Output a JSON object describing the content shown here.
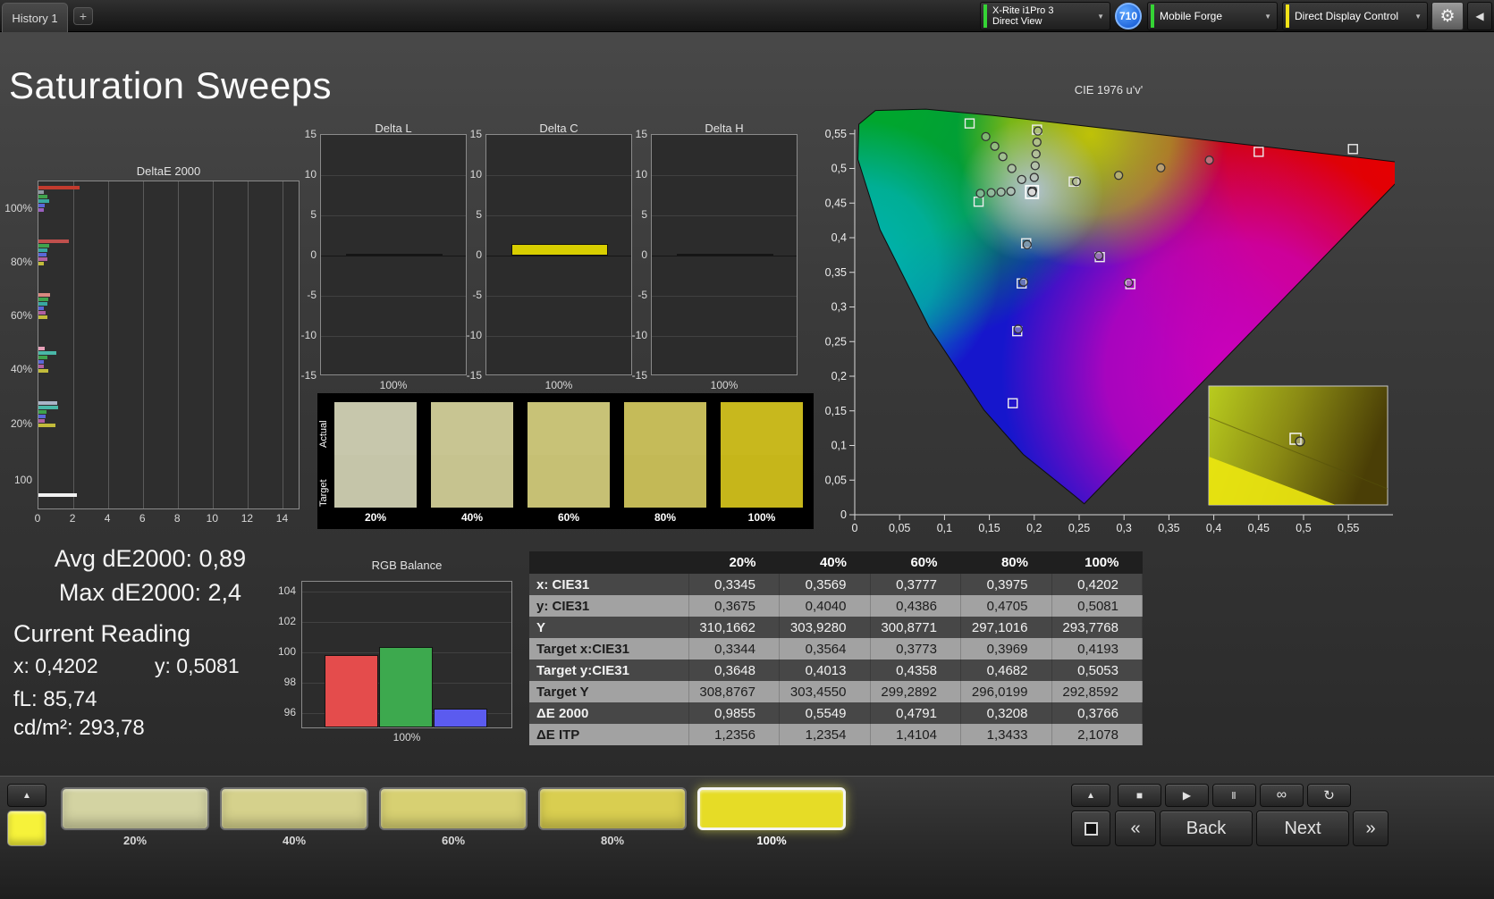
{
  "top_bar": {
    "tab_label": "History 1",
    "add_tab_label": "+",
    "meter_line1": "X-Rite i1Pro 3",
    "meter_line2": "Direct View",
    "meter_status_color": "#35d435",
    "badge_label": "710",
    "workflow_label": "Mobile Forge",
    "workflow_status_color": "#35d435",
    "display_label": "Direct Display Control",
    "display_status_color": "#f2e318",
    "dropdown_icon": "▼",
    "gear_icon": "⚙",
    "collapse_icon": "◀"
  },
  "page": {
    "title": "Saturation Sweeps"
  },
  "stats": {
    "avg_label": "Avg dE2000: 0,89",
    "max_label": "Max dE2000: 2,4",
    "current_heading": "Current Reading",
    "x_label": "x: 0,4202",
    "y_label": "y: 0,5081",
    "fl_label": "fL: 85,74",
    "cd_label": "cd/m²: 293,78"
  },
  "swatches": {
    "row_label_top": "Actual",
    "row_label_bottom": "Target",
    "items": [
      {
        "label": "20%",
        "actual": "#c7c7ac",
        "target": "#c5c5a9"
      },
      {
        "label": "40%",
        "actual": "#c8c592",
        "target": "#c6c38f"
      },
      {
        "label": "60%",
        "actual": "#c8c277",
        "target": "#c6c074"
      },
      {
        "label": "80%",
        "actual": "#c5bb59",
        "target": "#c3b956"
      },
      {
        "label": "100%",
        "actual": "#c8b81d",
        "target": "#c6b61a"
      }
    ]
  },
  "results_table": {
    "headers": [
      "",
      "20%",
      "40%",
      "60%",
      "80%",
      "100%"
    ],
    "rows": [
      {
        "label": "x: CIE31",
        "values": [
          "0,3345",
          "0,3569",
          "0,3777",
          "0,3975",
          "0,4202"
        ]
      },
      {
        "label": "y: CIE31",
        "values": [
          "0,3675",
          "0,4040",
          "0,4386",
          "0,4705",
          "0,5081"
        ]
      },
      {
        "label": "Y",
        "values": [
          "310,1662",
          "303,9280",
          "300,8771",
          "297,1016",
          "293,7768"
        ]
      },
      {
        "label": "Target x:CIE31",
        "values": [
          "0,3344",
          "0,3564",
          "0,3773",
          "0,3969",
          "0,4193"
        ]
      },
      {
        "label": "Target y:CIE31",
        "values": [
          "0,3648",
          "0,4013",
          "0,4358",
          "0,4682",
          "0,5053"
        ]
      },
      {
        "label": "Target Y",
        "values": [
          "308,8767",
          "303,4550",
          "299,2892",
          "296,0199",
          "292,8592"
        ]
      },
      {
        "label": "ΔE 2000",
        "values": [
          "0,9855",
          "0,5549",
          "0,4791",
          "0,3208",
          "0,3766"
        ]
      },
      {
        "label": "ΔE ITP",
        "values": [
          "1,2356",
          "1,2354",
          "1,4104",
          "1,3433",
          "2,1078"
        ]
      }
    ]
  },
  "chart_data": [
    {
      "id": "deltaE2000",
      "type": "bar",
      "orientation": "horizontal",
      "title": "DeltaE 2000",
      "xlim": [
        0,
        15
      ],
      "xticks": [
        0,
        2,
        4,
        6,
        8,
        10,
        12,
        14
      ],
      "ytick_labels": [
        "100%",
        "80%",
        "60%",
        "40%",
        "20%",
        "100"
      ],
      "groups": [
        {
          "label": "100%",
          "bars": [
            {
              "color": "#c23b2e",
              "value": 2.35
            },
            {
              "color": "#8f98a3",
              "value": 0.3
            },
            {
              "color": "#3fa34d",
              "value": 0.5
            },
            {
              "color": "#38a8a0",
              "value": 0.62
            },
            {
              "color": "#5a67d8",
              "value": 0.38
            },
            {
              "color": "#9a5fc0",
              "value": 0.3
            }
          ]
        },
        {
          "label": "80%",
          "bars": [
            {
              "color": "#c0504d",
              "value": 1.75
            },
            {
              "color": "#3fa34d",
              "value": 0.6
            },
            {
              "color": "#38a8a0",
              "value": 0.5
            },
            {
              "color": "#5a67d8",
              "value": 0.45
            },
            {
              "color": "#b05fa0",
              "value": 0.5
            },
            {
              "color": "#c2bb3a",
              "value": 0.3
            }
          ]
        },
        {
          "label": "60%",
          "bars": [
            {
              "color": "#d98880",
              "value": 0.68
            },
            {
              "color": "#3fa34d",
              "value": 0.55
            },
            {
              "color": "#38a8a0",
              "value": 0.5
            },
            {
              "color": "#5a67d8",
              "value": 0.3
            },
            {
              "color": "#b05fa0",
              "value": 0.42
            },
            {
              "color": "#c2bb3a",
              "value": 0.5
            }
          ]
        },
        {
          "label": "40%",
          "bars": [
            {
              "color": "#e6a0b8",
              "value": 0.38
            },
            {
              "color": "#49b8a8",
              "value": 1.0
            },
            {
              "color": "#3fa34d",
              "value": 0.5
            },
            {
              "color": "#5a67d8",
              "value": 0.33
            },
            {
              "color": "#b05fa0",
              "value": 0.3
            },
            {
              "color": "#c2bb3a",
              "value": 0.55
            }
          ]
        },
        {
          "label": "20%",
          "bars": [
            {
              "color": "#aab4c8",
              "value": 1.05
            },
            {
              "color": "#49b8a8",
              "value": 1.15
            },
            {
              "color": "#3fa34d",
              "value": 0.45
            },
            {
              "color": "#5a67d8",
              "value": 0.4
            },
            {
              "color": "#b05fa0",
              "value": 0.35
            },
            {
              "color": "#c2bb3a",
              "value": 0.98
            }
          ]
        },
        {
          "label": "100",
          "bars": [
            {
              "color": "#f2f2f2",
              "value": 2.2
            }
          ]
        }
      ]
    },
    {
      "id": "deltaL",
      "type": "bar",
      "title": "Delta L",
      "xlabel": "100%",
      "categories": [
        "100%"
      ],
      "values": [
        0.1
      ],
      "ylim": [
        -15,
        15
      ],
      "yticks": [
        15,
        10,
        5,
        0,
        -5,
        -10,
        -15
      ],
      "bar_color": "#d8ce00"
    },
    {
      "id": "deltaC",
      "type": "bar",
      "title": "Delta C",
      "xlabel": "100%",
      "categories": [
        "100%"
      ],
      "values": [
        1.5
      ],
      "ylim": [
        -15,
        15
      ],
      "yticks": [
        15,
        10,
        5,
        0,
        -5,
        -10,
        -15
      ],
      "bar_color": "#d8ce00"
    },
    {
      "id": "deltaH",
      "type": "bar",
      "title": "Delta H",
      "xlabel": "100%",
      "categories": [
        "100%"
      ],
      "values": [
        0.05
      ],
      "ylim": [
        -15,
        15
      ],
      "yticks": [
        15,
        10,
        5,
        0,
        -5,
        -10,
        -15
      ],
      "bar_color": "#d8ce00"
    },
    {
      "id": "cie",
      "type": "scatter",
      "title": "CIE 1976 u'v'",
      "xlim": [
        0,
        0.6
      ],
      "ylim": [
        0,
        0.6
      ],
      "tick_values": [
        0,
        0.05,
        0.1,
        0.15,
        0.2,
        0.25,
        0.3,
        0.35,
        0.4,
        0.45,
        0.5,
        0.55
      ],
      "tick_labels": [
        "0",
        "0,05",
        "0,1",
        "0,15",
        "0,2",
        "0,25",
        "0,3",
        "0,35",
        "0,4",
        "0,45",
        "0,5",
        "0,55"
      ],
      "measured": [
        {
          "u": 0.198,
          "v": 0.468
        },
        {
          "u": 0.2,
          "v": 0.487
        },
        {
          "u": 0.201,
          "v": 0.504
        },
        {
          "u": 0.202,
          "v": 0.521
        },
        {
          "u": 0.203,
          "v": 0.538
        },
        {
          "u": 0.204,
          "v": 0.554
        },
        {
          "u": 0.146,
          "v": 0.546
        },
        {
          "u": 0.156,
          "v": 0.532
        },
        {
          "u": 0.165,
          "v": 0.517
        },
        {
          "u": 0.175,
          "v": 0.5
        },
        {
          "u": 0.186,
          "v": 0.484
        },
        {
          "u": 0.247,
          "v": 0.481
        },
        {
          "u": 0.294,
          "v": 0.49
        },
        {
          "u": 0.341,
          "v": 0.501
        },
        {
          "u": 0.395,
          "v": 0.512
        },
        {
          "u": 0.14,
          "v": 0.464
        },
        {
          "u": 0.152,
          "v": 0.465
        },
        {
          "u": 0.163,
          "v": 0.466
        },
        {
          "u": 0.174,
          "v": 0.467
        },
        {
          "u": 0.192,
          "v": 0.39
        },
        {
          "u": 0.272,
          "v": 0.374
        },
        {
          "u": 0.305,
          "v": 0.335
        },
        {
          "u": 0.188,
          "v": 0.336
        },
        {
          "u": 0.182,
          "v": 0.268
        }
      ],
      "targets": [
        {
          "u": 0.45,
          "v": 0.524
        },
        {
          "u": 0.555,
          "v": 0.528
        },
        {
          "u": 0.244,
          "v": 0.481
        },
        {
          "u": 0.128,
          "v": 0.565
        },
        {
          "u": 0.138,
          "v": 0.452
        },
        {
          "u": 0.191,
          "v": 0.392
        },
        {
          "u": 0.273,
          "v": 0.372
        },
        {
          "u": 0.307,
          "v": 0.333
        },
        {
          "u": 0.186,
          "v": 0.334
        },
        {
          "u": 0.181,
          "v": 0.265
        },
        {
          "u": 0.176,
          "v": 0.161
        },
        {
          "u": 0.203,
          "v": 0.556
        }
      ],
      "current": {
        "u": 0.1975,
        "v": 0.466
      }
    },
    {
      "id": "rgb_balance",
      "type": "bar",
      "title": "RGB Balance",
      "xlabel": "100%",
      "categories": [
        "Red",
        "Green",
        "Blue"
      ],
      "values": [
        99.8,
        100.35,
        96.3
      ],
      "colors": [
        "#e44c4c",
        "#3da94e",
        "#5b5bef"
      ],
      "ylim": [
        95,
        104.6
      ],
      "yticks": [
        104,
        102,
        100,
        98,
        96
      ]
    }
  ],
  "bottom_bar": {
    "pattern_nav_up_icon": "▲",
    "pattern_color": "#f6f23a",
    "levels": [
      {
        "label": "20%",
        "color": "#d3d3a2",
        "active": false
      },
      {
        "label": "40%",
        "color": "#d5d18c",
        "active": false
      },
      {
        "label": "60%",
        "color": "#d7d072",
        "active": false
      },
      {
        "label": "80%",
        "color": "#d9ce50",
        "active": false
      },
      {
        "label": "100%",
        "color": "#e6dc26",
        "active": true
      }
    ],
    "meter_nav_up_icon": "▲",
    "transport": [
      {
        "name": "stop",
        "icon": "■"
      },
      {
        "name": "play",
        "icon": "▶"
      },
      {
        "name": "pause",
        "icon": "Ⅱ"
      },
      {
        "name": "continuous",
        "icon": "∞"
      },
      {
        "name": "refresh",
        "icon": "↻"
      }
    ],
    "nav": {
      "first": "«",
      "back": "Back",
      "next": "Next",
      "last": "»"
    }
  }
}
